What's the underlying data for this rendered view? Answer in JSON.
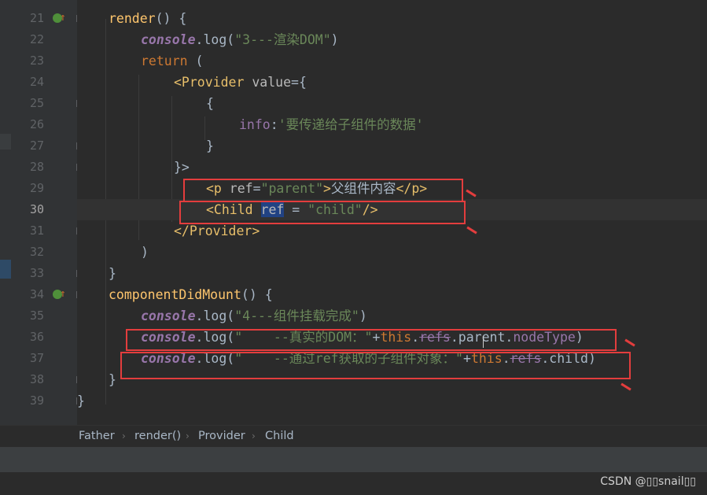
{
  "editor": {
    "line_numbers": [
      "21",
      "22",
      "23",
      "24",
      "25",
      "26",
      "27",
      "28",
      "29",
      "30",
      "31",
      "32",
      "33",
      "34",
      "35",
      "36",
      "37",
      "38",
      "39"
    ],
    "l21": {
      "fn": "render",
      "rest": "() {"
    },
    "l22": {
      "obj": "console",
      "mid": ".log(",
      "str": "\"3---渲染DOM\"",
      "end": ")"
    },
    "l23": {
      "kw": "return",
      "rest": " ("
    },
    "l24": {
      "tag": "<Provider",
      "attr": " value",
      "rest": "={"
    },
    "l25": {
      "text": "{"
    },
    "l26": {
      "prop": "info",
      "mid": ":",
      "str": "'要传递给子组件的数据'"
    },
    "l27": {
      "text": "}"
    },
    "l28": {
      "text": "}>"
    },
    "l29": {
      "tag1": "<p",
      "attr": " ref",
      "eq": "=",
      "str": "\"parent\"",
      "tag2": ">",
      "text": "父组件内容",
      "tag3": "</p>"
    },
    "l30": {
      "tag1": "<Child",
      "sp": " ",
      "sel": "ref",
      "eq": " = ",
      "str": "\"child\"",
      "tag2": "/>"
    },
    "l31": {
      "tag": "</Provider>"
    },
    "l32": {
      "text": ")"
    },
    "l33": {
      "text": "}"
    },
    "l34": {
      "fn": "componentDidMount",
      "rest": "() {"
    },
    "l35": {
      "obj": "console",
      "mid": ".log(",
      "str": "\"4---组件挂载完成\"",
      "end": ")"
    },
    "l36": {
      "obj": "console",
      "mid": ".log(",
      "str": "\"    --真实的DOM：\"",
      "plus": "+",
      "kw": "this",
      "dot1": ".",
      "strike": "refs",
      "dot2": ".parent.",
      "prop": "nodeType",
      "end": ")"
    },
    "l37": {
      "obj": "console",
      "mid": ".log(",
      "str": "\"    --通过ref获取的子组件对象：\"",
      "plus": "+",
      "kw": "this",
      "dot1": ".",
      "strike": "refs",
      "end": ".child)"
    },
    "l38": {
      "text": "}"
    },
    "l39": {
      "text": "}"
    }
  },
  "breadcrumb": [
    "Father",
    "render()",
    "Provider",
    "Child"
  ],
  "breadcrumb_separator": "›",
  "watermark": "CSDN @\u0000\u0000snail\u0000\u0000",
  "watermark_display": "CSDN @▯▯snail▯▯",
  "colors": {
    "annotation_red": "#e33d3d",
    "keyword": "#cc7832",
    "string": "#6a8759",
    "function": "#ffc66d",
    "tag": "#e8bf6a"
  }
}
